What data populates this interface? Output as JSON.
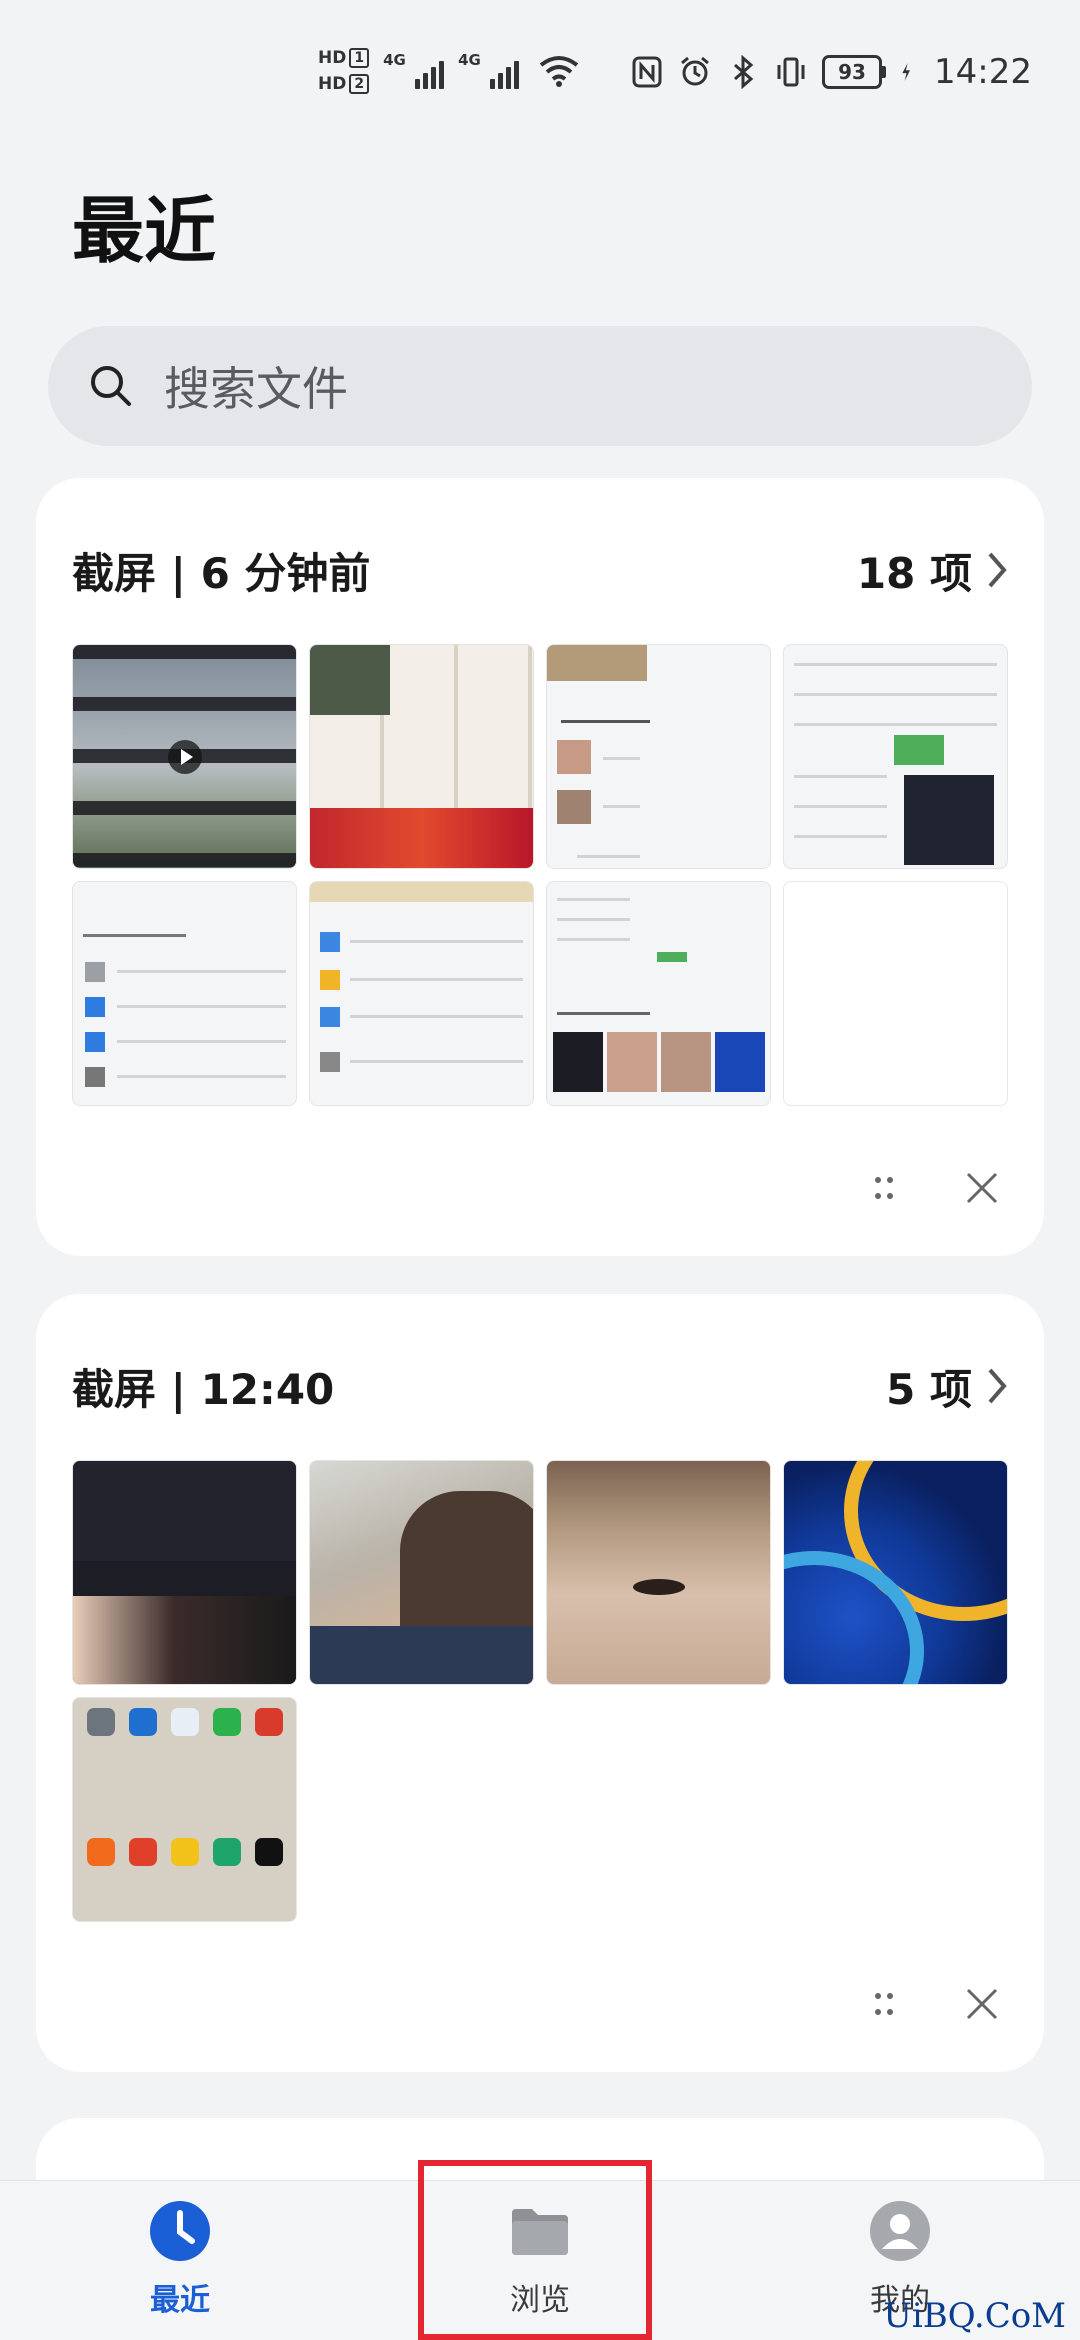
{
  "status_bar": {
    "hd1": "HD",
    "hd1_num": "1",
    "hd2": "HD",
    "hd2_num": "2",
    "net1": "4G",
    "net2": "4G",
    "battery": "93",
    "time": "14:22",
    "icons": [
      "nfc-icon",
      "alarm-icon",
      "bluetooth-icon",
      "vibrate-icon",
      "battery-icon",
      "charging-icon"
    ]
  },
  "page": {
    "title": "最近"
  },
  "search": {
    "placeholder": "搜索文件"
  },
  "groups": [
    {
      "title": "截屏 | 6 分钟前",
      "count": "18 项"
    },
    {
      "title": "截屏 | 12:40",
      "count": "5 项"
    }
  ],
  "nav": {
    "items": [
      {
        "label": "最近",
        "icon": "clock-icon",
        "active": true
      },
      {
        "label": "浏览",
        "icon": "folder-icon",
        "active": false
      },
      {
        "label": "我的",
        "icon": "avatar-icon",
        "active": false
      }
    ]
  },
  "watermark": "UiBQ.CoM",
  "colors": {
    "accent": "#1a5fd6",
    "highlight": "#e3262f",
    "background": "#f1f3f5"
  }
}
